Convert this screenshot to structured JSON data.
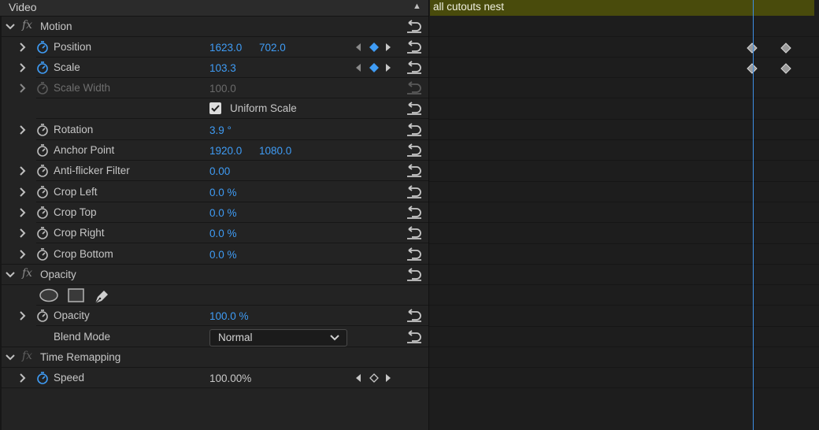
{
  "panel": {
    "title": "Video"
  },
  "clip": {
    "name": "all cutouts nest",
    "color": "#494b0c"
  },
  "effects": {
    "motion": {
      "name": "Motion",
      "position": {
        "label": "Position",
        "x": "1623.0",
        "y": "702.0"
      },
      "scale": {
        "label": "Scale",
        "value": "103.3"
      },
      "scale_width": {
        "label": "Scale Width",
        "value": "100.0"
      },
      "uniform_scale": {
        "label": "Uniform Scale",
        "checked": true
      },
      "rotation": {
        "label": "Rotation",
        "value": "3.9 °"
      },
      "anchor_point": {
        "label": "Anchor Point",
        "x": "1920.0",
        "y": "1080.0"
      },
      "anti_flicker": {
        "label": "Anti-flicker Filter",
        "value": "0.00"
      },
      "crop_left": {
        "label": "Crop Left",
        "value": "0.0 %"
      },
      "crop_top": {
        "label": "Crop Top",
        "value": "0.0 %"
      },
      "crop_right": {
        "label": "Crop Right",
        "value": "0.0 %"
      },
      "crop_bottom": {
        "label": "Crop Bottom",
        "value": "0.0 %"
      }
    },
    "opacity": {
      "name": "Opacity",
      "opacity": {
        "label": "Opacity",
        "value": "100.0 %"
      },
      "blend_mode": {
        "label": "Blend Mode",
        "value": "Normal"
      }
    },
    "time_remapping": {
      "name": "Time Remapping",
      "speed": {
        "label": "Speed",
        "value": "100.00%"
      }
    }
  },
  "icons": [
    "chevron-right-icon",
    "chevron-down-icon",
    "fx-icon",
    "stopwatch-icon",
    "reset-icon",
    "keyframe-nav-icon",
    "ellipse-mask-icon",
    "rectangle-mask-icon",
    "pen-mask-icon",
    "dropdown-chevron-icon"
  ],
  "colors": {
    "value_blue": "#3f9cf5",
    "playhead": "#3d8fe6"
  }
}
